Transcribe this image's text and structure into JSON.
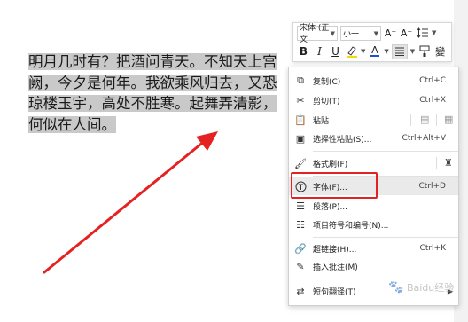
{
  "document": {
    "lines": [
      "明月几时有？把酒问青天。不知天上宫",
      "阙，今夕是何年。我欲乘风归去，又恐",
      "琼楼玉宇，高处不胜寒。起舞弄清影，",
      "何似在人间。"
    ]
  },
  "mini_toolbar": {
    "font_name": "宋体 (正文",
    "font_size": "小一",
    "grow_label": "A⁺",
    "shrink_label": "A⁻",
    "bold_label": "B",
    "italic_label": "I",
    "underline_label": "U",
    "font_color_label": "A",
    "font_color": "#1f4fd6",
    "highlight_color": "#f5d90a"
  },
  "context_menu": {
    "items": [
      {
        "label": "复制(C)",
        "shortcut": "Ctrl+C"
      },
      {
        "label": "剪切(T)",
        "shortcut": "Ctrl+X"
      },
      {
        "label": "粘贴",
        "shortcut": ""
      },
      {
        "label": "选择性粘贴(S)...",
        "shortcut": "Ctrl+Alt+V"
      },
      {
        "label": "格式刷(F)",
        "shortcut": ""
      },
      {
        "label": "字体(F)...",
        "shortcut": "Ctrl+D"
      },
      {
        "label": "段落(P)...",
        "shortcut": ""
      },
      {
        "label": "项目符号和编号(N)...",
        "shortcut": ""
      },
      {
        "label": "超链接(H)...",
        "shortcut": "Ctrl+K"
      },
      {
        "label": "插入批注(M)",
        "shortcut": ""
      },
      {
        "label": "短句翻译(T)",
        "shortcut": ""
      }
    ]
  },
  "watermark": {
    "text": "Baidu经验"
  },
  "colors": {
    "annotation_red": "#e52222",
    "selection_gray": "#c9c9c9"
  }
}
